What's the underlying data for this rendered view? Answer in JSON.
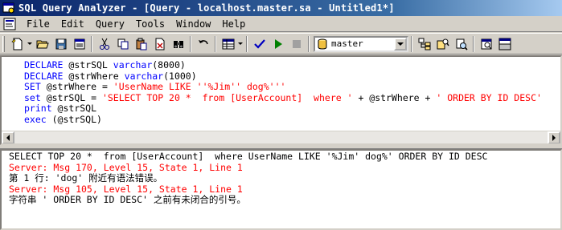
{
  "window": {
    "title": "SQL Query Analyzer - [Query - localhost.master.sa - Untitled1*]"
  },
  "menu": {
    "items": [
      {
        "label": "File"
      },
      {
        "label": "Edit"
      },
      {
        "label": "Query"
      },
      {
        "label": "Tools"
      },
      {
        "label": "Window"
      },
      {
        "label": "Help"
      }
    ]
  },
  "toolbar": {
    "database": "master",
    "icons": [
      "new-query-icon",
      "open-icon",
      "save-icon",
      "insert-template-icon",
      "cut-icon",
      "copy-icon",
      "paste-icon",
      "clear-icon",
      "find-icon",
      "undo-icon",
      "results-mode-icon",
      "parse-icon",
      "execute-icon",
      "stop-icon",
      "database-icon",
      "object-browser-icon",
      "object-search-icon",
      "execution-plan-icon",
      "properties-icon",
      "results-pane-icon"
    ]
  },
  "editor": {
    "lines": [
      [
        {
          "t": "DECLARE ",
          "c": "kw"
        },
        {
          "t": "@strSQL ",
          "c": "txt"
        },
        {
          "t": "varchar",
          "c": "kw"
        },
        {
          "t": "(8000)",
          "c": "txt"
        }
      ],
      [
        {
          "t": "DECLARE ",
          "c": "kw"
        },
        {
          "t": "@strWhere ",
          "c": "txt"
        },
        {
          "t": "varchar",
          "c": "kw"
        },
        {
          "t": "(1000)",
          "c": "txt"
        }
      ],
      [
        {
          "t": "SET ",
          "c": "kw"
        },
        {
          "t": "@strWhere = ",
          "c": "txt"
        },
        {
          "t": "'UserName LIKE ''%Jim'' dog%'''",
          "c": "str"
        }
      ],
      [
        {
          "t": "set ",
          "c": "kw"
        },
        {
          "t": "@strSQL = ",
          "c": "txt"
        },
        {
          "t": "'SELECT TOP 20 *  from [UserAccount]  where '",
          "c": "str"
        },
        {
          "t": " + @strWhere + ",
          "c": "txt"
        },
        {
          "t": "' ORDER BY ID DESC'",
          "c": "str"
        }
      ],
      [
        {
          "t": "print ",
          "c": "kw"
        },
        {
          "t": "@strSQL",
          "c": "txt"
        }
      ],
      [
        {
          "t": "exec ",
          "c": "kw"
        },
        {
          "t": "(@strSQL)",
          "c": "txt"
        }
      ]
    ]
  },
  "results": {
    "lines": [
      {
        "text": "SELECT TOP 20 *  from [UserAccount]  where UserName LIKE '%Jim' dog%' ORDER BY ID DESC",
        "color": "blk"
      },
      {
        "text": "Server: Msg 170, Level 15, State 1, Line 1",
        "color": "red"
      },
      {
        "text": "第 1 行: 'dog' 附近有语法错误。",
        "color": "blk"
      },
      {
        "text": "Server: Msg 105, Level 15, State 1, Line 1",
        "color": "red"
      },
      {
        "text": "字符串 ' ORDER BY ID DESC' 之前有未闭合的引号。",
        "color": "blk"
      }
    ]
  }
}
